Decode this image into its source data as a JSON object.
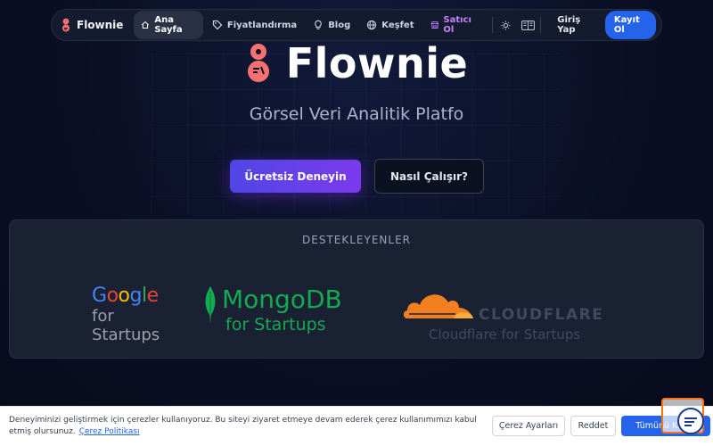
{
  "nav": {
    "brand": "Flownie",
    "items": [
      {
        "label": "Ana Sayfa",
        "icon": "home-icon",
        "active": true
      },
      {
        "label": "Fiyatlandırma",
        "icon": "tag-icon"
      },
      {
        "label": "Blog",
        "icon": "lightbulb-icon"
      },
      {
        "label": "Keşfet",
        "icon": "globe-icon"
      },
      {
        "label": "Satıcı Ol",
        "icon": "store-icon"
      }
    ],
    "login": "Giriş Yap",
    "signup": "Kayıt Ol"
  },
  "hero": {
    "title": "Flownie",
    "subtitle": "Görsel Veri Analitik Platfo",
    "cta_primary": "Ücretsiz Deneyin",
    "cta_secondary": "Nasıl Çalışır?"
  },
  "sponsors": {
    "title": "DESTEKLEYENLER",
    "google_word": [
      "G",
      "o",
      "o",
      "g",
      "l",
      "e"
    ],
    "google_line1": "for",
    "google_line2": "Startups",
    "mongo_word": "MongoDB",
    "mongo_sub": "for Startups",
    "cf_word": "CLOUDFLARE",
    "cf_sub": "Cloudflare for Startups"
  },
  "cookie": {
    "text": "Deneyiminizi geliştirmek için çerezler kullanıyoruz. Bu siteyi ziyaret etmeye devam ederek çerez kullanımımızı kabul etmiş olursunuz.",
    "link": "Çerez Politikası",
    "settings": "Çerez Ayarları",
    "reject": "Reddet",
    "accept": "Tümünü Kabul"
  },
  "colors": {
    "accent": "#2563eb",
    "brand_orange": "#f87171",
    "seller_purple": "#c084fc",
    "google": [
      "#4285F4",
      "#EA4335",
      "#FBBC05",
      "#4285F4",
      "#34A853",
      "#EA4335"
    ],
    "mongo_green": "#13aa52",
    "cloudflare_orange": "#f38020"
  }
}
